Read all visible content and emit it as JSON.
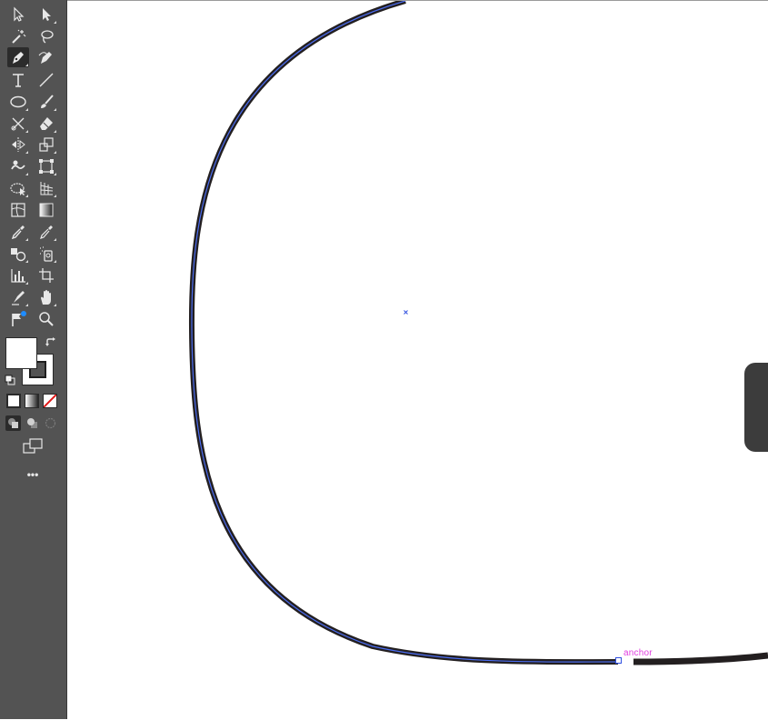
{
  "toolbar": {
    "tools": [
      {
        "name": "selection-tool",
        "icon": "arrow-icon"
      },
      {
        "name": "direct-selection-tool",
        "icon": "white-arrow-icon"
      },
      {
        "name": "magic-wand-tool",
        "icon": "magic-wand-icon"
      },
      {
        "name": "lasso-tool",
        "icon": "lasso-icon"
      },
      {
        "name": "pen-tool",
        "icon": "pen-icon",
        "active": true
      },
      {
        "name": "curvature-tool",
        "icon": "curvature-pen-icon"
      },
      {
        "name": "type-tool",
        "icon": "type-icon"
      },
      {
        "name": "line-segment-tool",
        "icon": "line-icon"
      },
      {
        "name": "ellipse-tool",
        "icon": "ellipse-icon"
      },
      {
        "name": "paintbrush-tool",
        "icon": "brush-icon"
      },
      {
        "name": "shaper-tool",
        "icon": "scissors-icon"
      },
      {
        "name": "eraser-tool",
        "icon": "eraser-icon"
      },
      {
        "name": "reflect-tool",
        "icon": "reflect-icon"
      },
      {
        "name": "scale-tool",
        "icon": "scale-icon"
      },
      {
        "name": "warp-tool",
        "icon": "warp-icon"
      },
      {
        "name": "free-transform-tool",
        "icon": "free-transform-icon"
      },
      {
        "name": "shape-builder-tool",
        "icon": "shape-builder-icon"
      },
      {
        "name": "perspective-grid-tool",
        "icon": "perspective-grid-icon"
      },
      {
        "name": "mesh-tool",
        "icon": "mesh-icon"
      },
      {
        "name": "gradient-tool",
        "icon": "gradient-icon"
      },
      {
        "name": "eyedropper-tool",
        "icon": "eyedropper-icon"
      },
      {
        "name": "measure-tool",
        "icon": "measure-icon"
      },
      {
        "name": "blend-tool",
        "icon": "blend-icon"
      },
      {
        "name": "symbol-sprayer-tool",
        "icon": "symbol-sprayer-icon"
      },
      {
        "name": "column-graph-tool",
        "icon": "graph-icon"
      },
      {
        "name": "artboard-tool",
        "icon": "artboard-icon"
      },
      {
        "name": "slice-tool",
        "icon": "slice-icon"
      },
      {
        "name": "hand-tool",
        "icon": "hand-icon"
      },
      {
        "name": "puppet-warp-tool",
        "icon": "puppet-warp-icon"
      },
      {
        "name": "zoom-tool",
        "icon": "magnifier-icon"
      }
    ],
    "fill_color": "#ffffff",
    "stroke_color": "#2a2a2a",
    "more_tools_label": "•••"
  },
  "canvas": {
    "path_color": "#231f20",
    "selection_color": "#4a6cf0",
    "anchor_hint": "anchor",
    "anchor_hint_color": "#e040e0"
  }
}
